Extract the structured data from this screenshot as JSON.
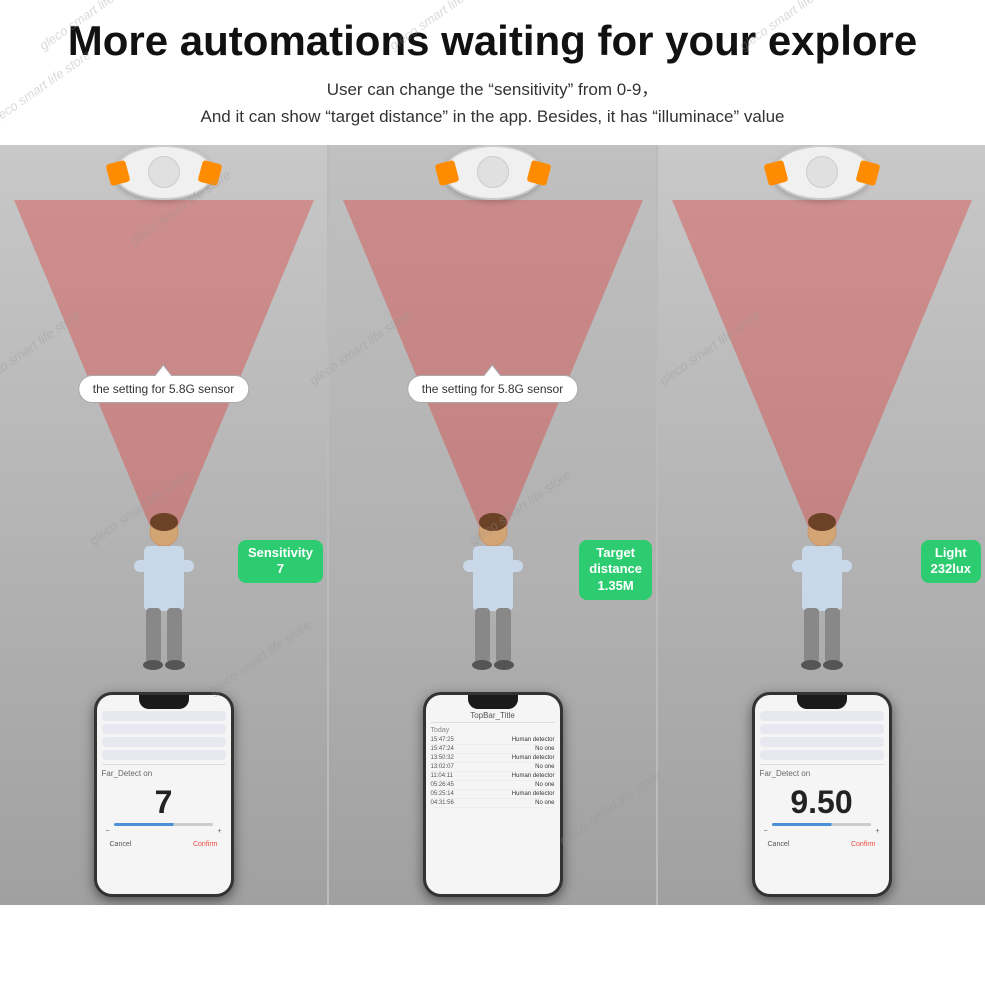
{
  "header": {
    "main_title": "More automations waiting for your explore",
    "subtitle_line1": "User can change the  “sensitivity”  from 0-9，",
    "subtitle_line2": "And it can show  “target distance”  in the app. Besides, it has  “illuminace”  value"
  },
  "watermarks": [
    "gleco smart life store",
    "gleco smart life store",
    "gleco smart life store",
    "gleco smart life store",
    "gleco smart life store",
    "gleco smart life store",
    "gleco smart life store",
    "gleco smart life store",
    "gleco smart life store",
    "gleco smart life store",
    "gleco smart life store",
    "gleco smart life store"
  ],
  "panels": [
    {
      "id": "panel-1",
      "bubble_text": "the setting for 5.8G sensor",
      "badge_text": "Sensitivity\n7",
      "phone_type": "sensitivity",
      "screen_label": "Far_Detect on",
      "screen_value": "7",
      "btn_cancel": "Cancel",
      "btn_confirm": "Confirm"
    },
    {
      "id": "panel-2",
      "bubble_text": "the setting for 5.8G sensor",
      "badge_text": "Target\ndistance\n1.35M",
      "phone_type": "log",
      "topbar_title": "TopBar_Title",
      "today_label": "Today",
      "logs": [
        {
          "time": "15:47:25",
          "event": "Human detector"
        },
        {
          "time": "15:47:24",
          "event": "No one"
        },
        {
          "time": "13:50:32",
          "event": "Human detector"
        },
        {
          "time": "13:02:07",
          "event": "No one"
        },
        {
          "time": "11:04:11",
          "event": "Human detector"
        },
        {
          "time": "05:26:45",
          "event": "No one"
        },
        {
          "time": "05:25:14",
          "event": "Human detector"
        },
        {
          "time": "04:31:56",
          "event": "No one"
        }
      ]
    },
    {
      "id": "panel-3",
      "bubble_text": "",
      "badge_text": "Light\n232lux",
      "phone_type": "illuminance",
      "screen_label": "Far_Detect on",
      "screen_value": "9.50",
      "btn_cancel": "Cancel",
      "btn_confirm": "Confirm"
    }
  ]
}
